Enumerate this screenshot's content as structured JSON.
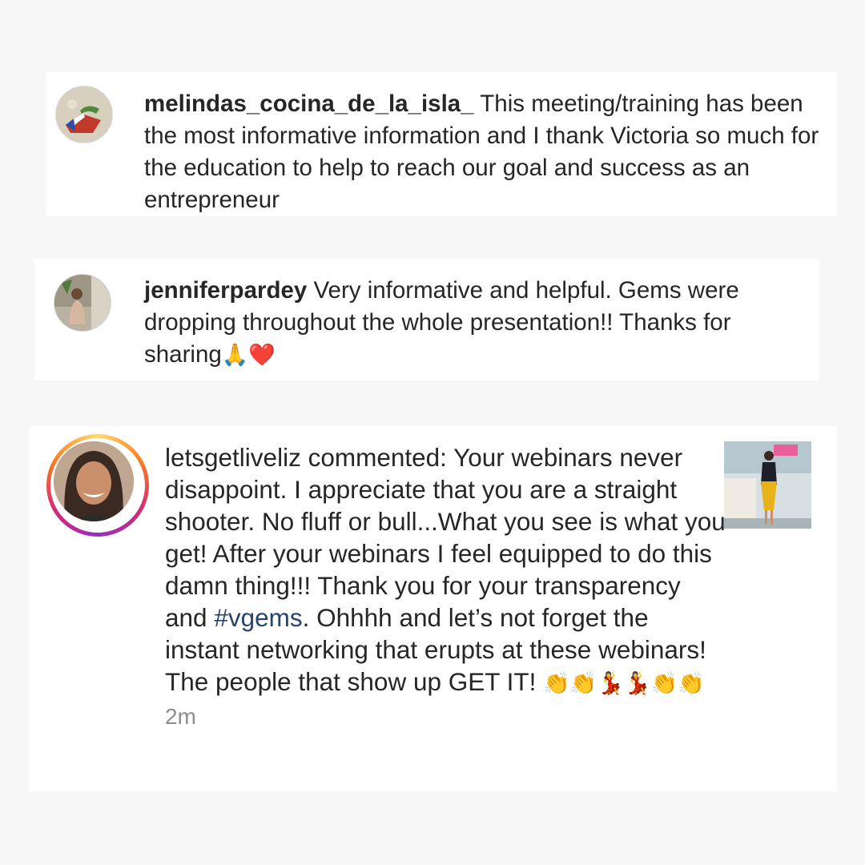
{
  "comments": [
    {
      "username": "melindas_cocina_de_la_isla_",
      "text": "This meeting/training has been the most informative information and I thank Victoria so much for the education to help to reach our goal and success as an entrepreneur"
    },
    {
      "username": "jenniferpardey",
      "text": "Very informative and helpful. Gems were dropping throughout the whole presentation!! Thanks for sharing",
      "emojis": "🙏❤️"
    },
    {
      "username": "letsgetliveliz",
      "text_before_hashtag": "commented: Your webinars never disappoint. I appreciate that you are a straight shooter.  No fluff or bull...What you see is what you get! After your webinars I feel equipped to do this damn thing!!! Thank you for your transparency and",
      "hashtag": "#vgems",
      "text_after_hashtag": ". Ohhhh and let’s not forget the instant networking that erupts at these webinars! The people that show up GET IT!",
      "emojis": "👏👏💃💃👏👏",
      "time": "2m"
    }
  ],
  "colors": {
    "text": "#262626",
    "hashtag": "#27456b",
    "timestamp": "#8e8e8e",
    "story_ring": [
      "#feda75",
      "#fa7e1e",
      "#d62976",
      "#962fbf"
    ]
  },
  "icons": {
    "avatar_1": "avatar-flag-logo",
    "avatar_2": "avatar-photo",
    "avatar_3": "avatar-photo-story-ring",
    "thumbnail": "post-thumbnail"
  }
}
